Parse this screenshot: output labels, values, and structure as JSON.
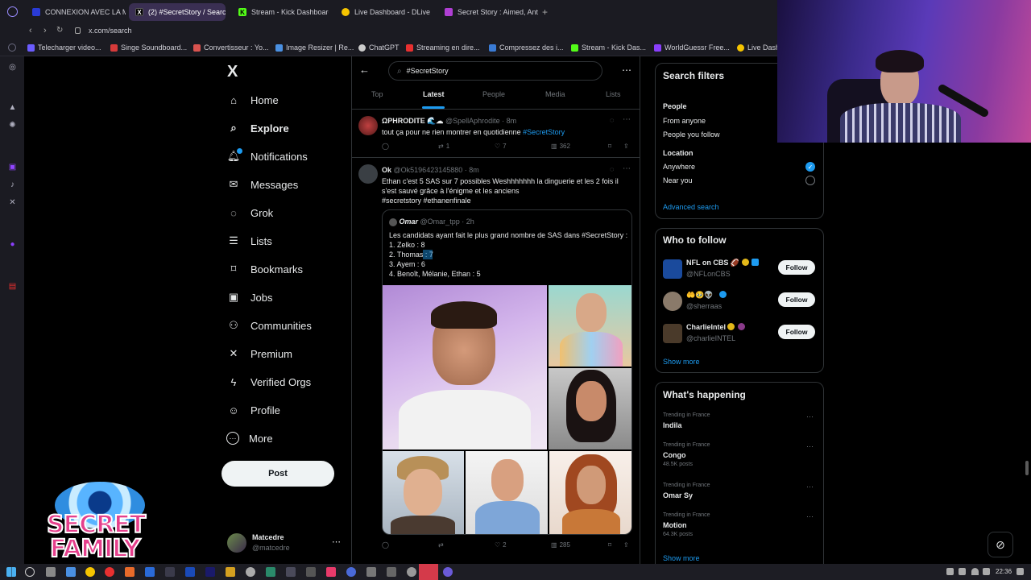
{
  "browser": {
    "tabs": [
      {
        "label": "CONNEXION AVEC LA M",
        "color": "#2a3bd6"
      },
      {
        "label": "(2) #SecretStory / Search",
        "color": "#000000",
        "active": true
      },
      {
        "label": "Stream - Kick Dashboard",
        "color": "#53fc18"
      },
      {
        "label": "Live Dashboard - DLive",
        "color": "#f5c400"
      },
      {
        "label": "Secret Story : Aimed, Ant",
        "color": "#b03fd4"
      }
    ],
    "new_tab": "+",
    "url": "x.com/search",
    "bookmarks": [
      {
        "label": "Telecharger video...",
        "color": "#6b5cff"
      },
      {
        "label": "Singe Soundboard...",
        "color": "#d63a3a"
      },
      {
        "label": "Convertisseur : Yo...",
        "color": "#d9534f"
      },
      {
        "label": "Image Resizer | Re...",
        "color": "#4a90e2"
      },
      {
        "label": "ChatGPT",
        "color": "#cccccc"
      },
      {
        "label": "Streaming en dire...",
        "color": "#e83030"
      },
      {
        "label": "Compressez des i...",
        "color": "#3a7bd5"
      },
      {
        "label": "Stream - Kick Das...",
        "color": "#53fc18"
      },
      {
        "label": "WorldGuessr Free...",
        "color": "#8a3ffc"
      },
      {
        "label": "Live Dash",
        "color": "#f5c400"
      }
    ]
  },
  "nav": {
    "logo": "X",
    "items": [
      {
        "label": "Home",
        "icon": "home-icon",
        "glyph": "⌂"
      },
      {
        "label": "Explore",
        "icon": "search-icon",
        "glyph": "⌕",
        "bold": true
      },
      {
        "label": "Notifications",
        "icon": "bell-icon",
        "glyph": "🔔︎"
      },
      {
        "label": "Messages",
        "icon": "mail-icon",
        "glyph": "✉"
      },
      {
        "label": "Grok",
        "icon": "grok-icon",
        "glyph": "◌"
      },
      {
        "label": "Lists",
        "icon": "list-icon",
        "glyph": "☰"
      },
      {
        "label": "Bookmarks",
        "icon": "bookmark-icon",
        "glyph": "⌑"
      },
      {
        "label": "Jobs",
        "icon": "briefcase-icon",
        "glyph": "▣"
      },
      {
        "label": "Communities",
        "icon": "people-icon",
        "glyph": "⚇"
      },
      {
        "label": "Premium",
        "icon": "x-icon",
        "glyph": "✕"
      },
      {
        "label": "Verified Orgs",
        "icon": "bolt-icon",
        "glyph": "ϟ"
      },
      {
        "label": "Profile",
        "icon": "person-icon",
        "glyph": "☺"
      },
      {
        "label": "More",
        "icon": "more-circle-icon",
        "glyph": "⋯"
      }
    ],
    "post_label": "Post",
    "account": {
      "name": "Matcedre",
      "handle": "@matcedre"
    }
  },
  "search": {
    "query": "#SecretStory",
    "tabs": [
      "Top",
      "Latest",
      "People",
      "Media",
      "Lists"
    ],
    "active_tab": "Latest"
  },
  "tweets": [
    {
      "name": "ΩPHRODITE 🌊☁",
      "handle": "@SpellAphrodite · 8m",
      "text": "tout ça pour ne rien montrer en quotidienne",
      "hashtag": "#SecretStory",
      "replies": "",
      "retweets": "1",
      "likes": "7",
      "views": "362"
    },
    {
      "name": "Ok",
      "handle": "@Ok5196423145880 · 8m",
      "text": "Ethan c'est 5 SAS sur 7 possibles Weshhhhhhh la dinguerie et les 2 fois il s'est sauvé grâce à l'énigme et les anciens",
      "hashtags": "#secretstory #ethanenfinale",
      "quote": {
        "name": "Omar",
        "handle": "@Omar_tpp · 2h",
        "intro": "Les candidats ayant fait le plus grand nombre de SAS dans #SecretStory :",
        "lines": [
          "1. Zelko : 8",
          "2. Thomas : 7",
          "3. Ayem : 6",
          "4. Benoît, Mélanie, Ethan : 5"
        ]
      },
      "replies": "",
      "retweets": "",
      "likes": "2",
      "views": "285"
    }
  ],
  "search_filters": {
    "title": "Search filters",
    "people_heading": "People",
    "people_options": [
      "From anyone",
      "People you follow"
    ],
    "location_heading": "Location",
    "location_options": [
      "Anywhere",
      "Near you"
    ],
    "advanced": "Advanced search"
  },
  "who_to_follow": {
    "title": "Who to follow",
    "accounts": [
      {
        "name": "NFL on CBS 🏈",
        "handle": "@NFLonCBS",
        "color": "#1a4a9c"
      },
      {
        "name": "🤲🥹👽",
        "handle": "@sherraas",
        "color": "#8a7a6a"
      },
      {
        "name": "CharlieIntel",
        "handle": "@charlieINTEL",
        "color": "#4a3a2a"
      }
    ],
    "follow_label": "Follow",
    "show_more": "Show more"
  },
  "whats_happening": {
    "title": "What's happening",
    "trends": [
      {
        "meta": "Trending in France",
        "name": "Indila",
        "posts": ""
      },
      {
        "meta": "Trending in France",
        "name": "Congo",
        "posts": "48.5K posts"
      },
      {
        "meta": "Trending in France",
        "name": "Omar Sy",
        "posts": ""
      },
      {
        "meta": "Trending in France",
        "name": "Motion",
        "posts": "64.3K posts"
      }
    ],
    "show_more": "Show more"
  },
  "overlay": {
    "logo_line1": "SECRET",
    "logo_line2": "FAMILY"
  },
  "taskbar": {
    "time": "22:36"
  }
}
